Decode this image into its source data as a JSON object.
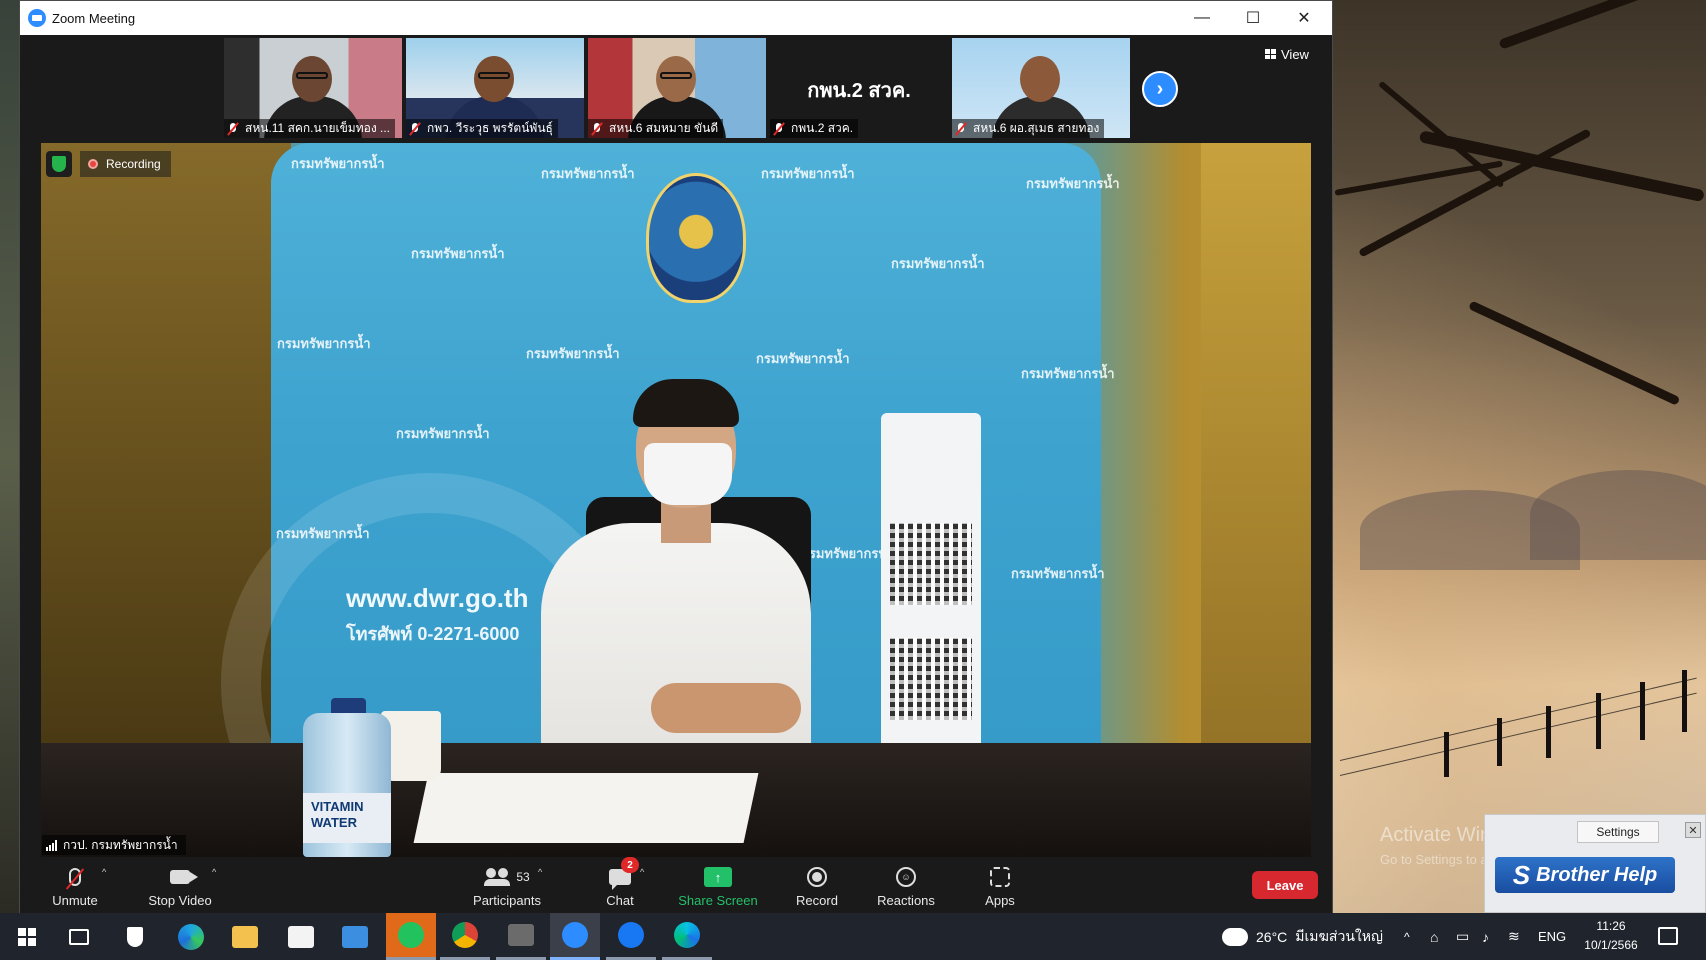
{
  "window": {
    "title": "Zoom Meeting",
    "controls": {
      "minimize": "—",
      "maximize": "☐",
      "close": "✕"
    }
  },
  "gallery": {
    "view_label": "View",
    "tiles": [
      {
        "name": "สหน.11 สคก.นายเข็มทอง ..."
      },
      {
        "name": "กพว. วีระวุธ พรรัตน์พันธุ์"
      },
      {
        "name": "สหน.6 สมหมาย ขันดี"
      },
      {
        "name": "กพน.2 สวค.",
        "display_text": "กพน.2 สวค."
      },
      {
        "name": "สหน.6 ผอ.สุเมธ สายทอง"
      }
    ],
    "next_glyph": "›"
  },
  "main_video": {
    "recording_label": "Recording",
    "speaker_name": "กวป. กรมทรัพยากรน้ำ",
    "backdrop_text": "กรมทรัพยากรน้ำ",
    "website_text": "www.dwr.go.th",
    "phone_text": "โทรศัพท์ 0-2271-6000",
    "bottle_text": "VITAMIN WATER"
  },
  "toolbar": {
    "unmute_label": "Unmute",
    "stop_video_label": "Stop Video",
    "participants_label": "Participants",
    "participants_count": "53",
    "chat_label": "Chat",
    "chat_badge": "2",
    "share_label": "Share Screen",
    "record_label": "Record",
    "reactions_label": "Reactions",
    "apps_label": "Apps",
    "leave_label": "Leave",
    "caret": "^"
  },
  "popup": {
    "settings_label": "Settings",
    "close_glyph": "✕",
    "help_label": "Brother Help",
    "help_glyph": "S"
  },
  "watermark": {
    "title": "Activate Windows",
    "subtitle": "Go to Settings to activate Windows."
  },
  "taskbar": {
    "weather_temp": "26°C",
    "weather_text": "มีเมฆส่วนใหญ่",
    "language": "ENG",
    "time": "11:26",
    "date": "10/1/2566",
    "tray_chevron": "^"
  },
  "colors": {
    "zoom_blue": "#2d8cff",
    "share_green": "#23c06a",
    "leave_red": "#d7272f",
    "recording_red": "#e8453c"
  }
}
